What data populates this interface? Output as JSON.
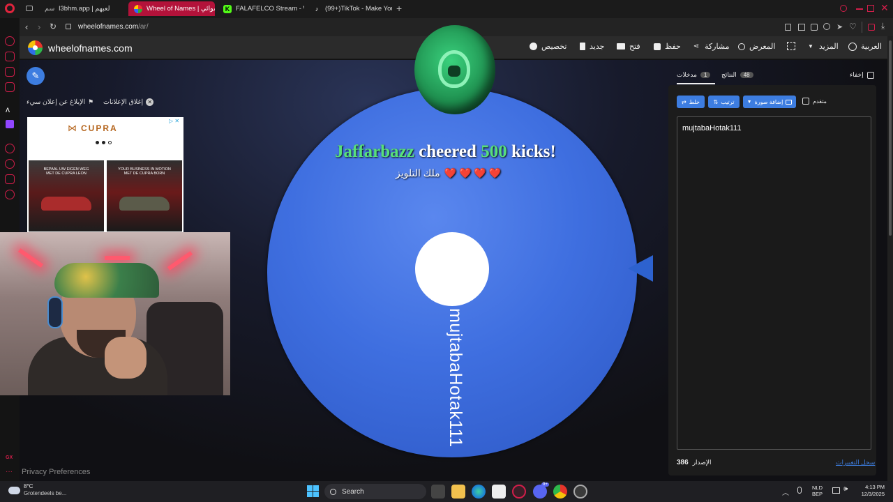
{
  "browser": {
    "tabs": [
      {
        "label": "l3bhm.app | لعبهم",
        "prefix": "سم",
        "active": false
      },
      {
        "label": "Wheel of Names | عشوائي",
        "active": true
      },
      {
        "label": "FALAFELCO Stream - Wa",
        "active": false
      },
      {
        "label": "(99+)TikTok - Make Your",
        "active": false
      }
    ],
    "new_tab": "+",
    "url_host": "wheelofnames.com",
    "url_path": "/ar/"
  },
  "header": {
    "brand": "wheelofnames.com",
    "nav": [
      {
        "label": "العربية",
        "icon": "globe-icon"
      },
      {
        "label": "المزيد",
        "icon": "chevron-down-icon"
      },
      {
        "label": "",
        "icon": "fullscreen-icon"
      },
      {
        "label": "المعرض",
        "icon": "search-icon"
      },
      {
        "label": "مشاركة",
        "icon": "share-icon"
      },
      {
        "label": "حفظ",
        "icon": "save-icon"
      },
      {
        "label": "فتح",
        "icon": "folder-icon"
      },
      {
        "label": "جديد",
        "icon": "file-icon"
      },
      {
        "label": "تخصيص",
        "icon": "palette-icon"
      }
    ]
  },
  "ads": {
    "hide_ads": "إغلاق الإعلانات",
    "report_ad": "الإبلاغ عن إعلان سيء",
    "brand": "CUPRA",
    "card1_text": "BEPAAL UW EIGEN WEG\nMET DE CUPRA LEON",
    "card2_text": "YOUR BUSINESS IN MOTION\nMET DE CUPRA BORN"
  },
  "overlay": {
    "donor": "Jaffarbazz",
    "cheered": "cheered",
    "amount": "500",
    "unit": "kicks!",
    "subtitle": "ملك التلويز",
    "hearts": "❤️ ❤️ ❤️ ❤️"
  },
  "wheel": {
    "entry": "mujtabaHotak111",
    "color": "#3f6fe0"
  },
  "panel": {
    "hide_label": "إخفاء",
    "tab_entries": "مدخلات",
    "entries_count": "1",
    "tab_results": "النتائج",
    "results_count": "48",
    "shuffle": "خلط",
    "sort": "ترتيب",
    "add_image": "إضافة صورة",
    "advanced": "متقدم",
    "entries_text": "mujtabaHotak111",
    "version_label": "الإصدار",
    "version": "386",
    "changelog": "سجل التغييرات"
  },
  "footer": {
    "privacy": "Privacy Preferences"
  },
  "taskbar": {
    "weather_temp": "8°C",
    "weather_desc": "Grotendeels be...",
    "search": "Search",
    "lang1": "NLD",
    "lang2": "BEP",
    "time": "4:13 PM",
    "date": "12/3/2025",
    "discord_badge": "9+"
  },
  "colors": {
    "accent": "#3d7de0",
    "opera_red": "#d21e4a",
    "donor_green": "#58e07a"
  }
}
